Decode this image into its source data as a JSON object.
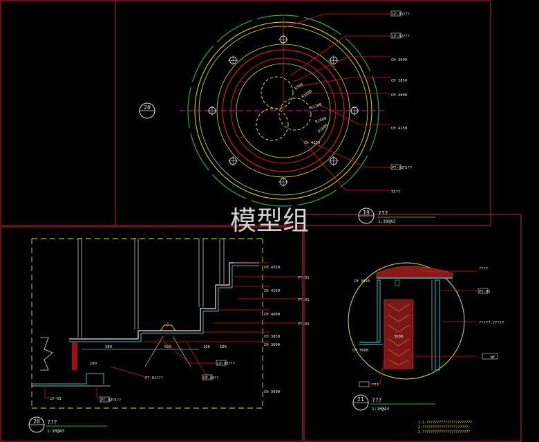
{
  "watermark": "模型组",
  "colors": {
    "background": "#000000",
    "frame": "#cc1f3a",
    "yellow": "#e6e600",
    "green": "#1fb81f",
    "red": "#e01818",
    "white": "#e6e6e6",
    "cyan": "#19c8c8",
    "magenta": "#c020c0"
  },
  "plan": {
    "section_marker": "20",
    "ceiling_labels": [
      "CH 3600",
      "CH 3850",
      "CH 4000",
      "CH 4150"
    ],
    "radius_labels": [
      "R500",
      "R1200",
      "R1200",
      "R1600",
      "R1800",
      "CH 4350"
    ],
    "material_tags": [
      {
        "tag": "LP-01",
        "text": "???"
      },
      {
        "tag": "LP-02",
        "text": "???"
      },
      {
        "tag": "PT-01",
        "text": "T5??"
      }
    ],
    "title_number": "19",
    "title_text": "???",
    "scale": "1:30@A3"
  },
  "section": {
    "ch_labels": [
      "CH 4350",
      "CH 4150",
      "CH 4000",
      "CH 3850",
      "CH 3600",
      "CH 3600"
    ],
    "tags": [
      "PT-01",
      "PT-01",
      "PT-01",
      "PT-01"
    ],
    "dimensions": [
      "380",
      "600",
      "100",
      "100",
      "180"
    ],
    "bottom_tags": [
      {
        "tag": "LP-03",
        "text": "???"
      },
      {
        "tag": "LP-04",
        "text": "??"
      },
      {
        "tag": "PT-01",
        "text": "???"
      },
      {
        "tag": "PT-02",
        "text": "T5??"
      }
    ],
    "title_number": "20",
    "title_text": "???",
    "scale": "1:10@A3"
  },
  "detail": {
    "ch_top": "CH 3850",
    "ch_bottom": "CH 3600",
    "labels": [
      "????",
      "PT-01",
      "?????.?????",
      "WF"
    ],
    "inner_dim": "3600",
    "bottom_tag": "???",
    "title_number": "21",
    "title_text": "???",
    "scale": "1:10@A3"
  },
  "notes": [
    "1.1.??????????????????????",
    "2.??????????????????????",
    "3.???????????????????????"
  ]
}
